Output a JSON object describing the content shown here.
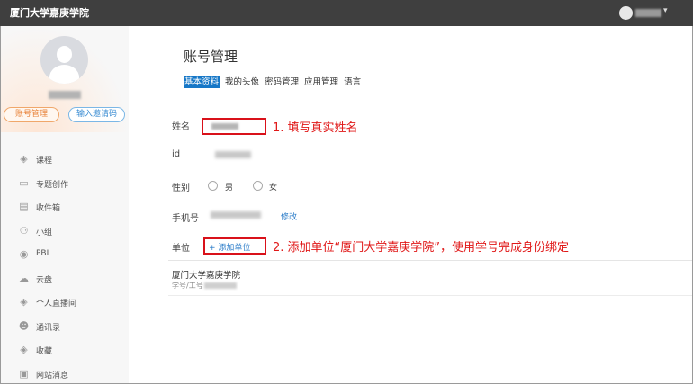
{
  "header": {
    "brand": "厦门大学嘉庚学院",
    "caret": "▾"
  },
  "sidebar": {
    "account_button": "账号管理",
    "invite_button": "输入邀请码",
    "items": [
      {
        "label": "课程",
        "icon": "course-icon",
        "glyph": "◈"
      },
      {
        "label": "专题创作",
        "icon": "topic-icon",
        "glyph": "▭"
      },
      {
        "label": "收件箱",
        "icon": "inbox-icon",
        "glyph": "▤"
      },
      {
        "label": "小组",
        "icon": "group-icon",
        "glyph": "⚇"
      },
      {
        "label": "PBL",
        "icon": "pbl-icon",
        "glyph": "◉"
      },
      {
        "label": "云盘",
        "icon": "cloud-icon",
        "glyph": "☁"
      },
      {
        "label": "个人直播间",
        "icon": "live-icon",
        "glyph": "◈"
      },
      {
        "label": "通讯录",
        "icon": "contacts-icon",
        "glyph": "☻"
      },
      {
        "label": "收藏",
        "icon": "favorite-icon",
        "glyph": "◈"
      },
      {
        "label": "网站消息",
        "icon": "message-icon",
        "glyph": "▣"
      }
    ]
  },
  "main": {
    "title": "账号管理",
    "tabs": [
      "基本资料",
      "我的头像",
      "密码管理",
      "应用管理",
      "语言"
    ],
    "fields": {
      "name_label": "姓名",
      "id_label": "id",
      "gender_label": "性别",
      "gender_options": [
        "男",
        "女"
      ],
      "phone_label": "手机号",
      "edit_link": "修改",
      "unit_label": "单位",
      "add_unit": "+ 添加单位"
    },
    "unit": {
      "name": "厦门大学嘉庚学院",
      "id_label": "学号/工号"
    }
  },
  "annotations": {
    "step1": "1. 填写真实姓名",
    "step2": "2. 添加单位“厦门大学嘉庚学院”，使用学号完成身份绑定"
  },
  "colors": {
    "accent": "#1677c7",
    "annotation": "#e01818",
    "topbar": "#3f3f3f"
  }
}
